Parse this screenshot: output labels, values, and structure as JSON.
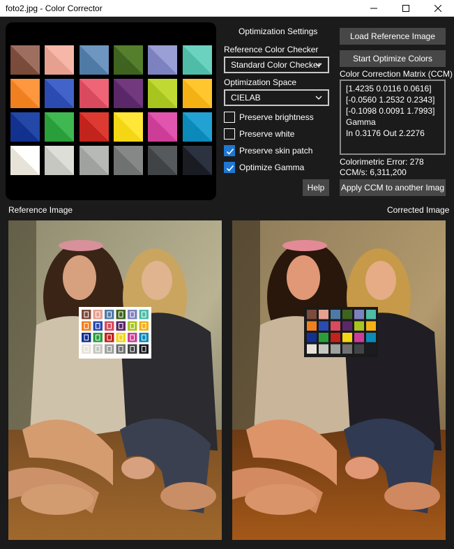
{
  "window": {
    "title": "foto2.jpg - Color Corrector",
    "minimize_icon": "minimize-icon",
    "maximize_icon": "maximize-icon",
    "close_icon": "close-icon"
  },
  "checker": {
    "patches": [
      [
        "#7b4b3b",
        "#9e6f60"
      ],
      [
        "#e6a090",
        "#f7b7a8"
      ],
      [
        "#4f7aa6",
        "#6e96c0"
      ],
      [
        "#3f6320",
        "#557f2c"
      ],
      [
        "#7d82bf",
        "#9a9fd6"
      ],
      [
        "#4fbca8",
        "#6bd2c0"
      ],
      [
        "#f0801f",
        "#ff9740"
      ],
      [
        "#2b4bb0",
        "#4263c9"
      ],
      [
        "#d94a5e",
        "#f06478"
      ],
      [
        "#5a2868",
        "#73397f"
      ],
      [
        "#a8c41f",
        "#c0da33"
      ],
      [
        "#f5b014",
        "#ffc62d"
      ],
      [
        "#13318f",
        "#2448a8"
      ],
      [
        "#2a9e3b",
        "#3fb852"
      ],
      [
        "#c2231c",
        "#dd3a32"
      ],
      [
        "#f3d614",
        "#ffe637"
      ],
      [
        "#cc3d97",
        "#e255ae"
      ],
      [
        "#0c8ab8",
        "#21a2d2"
      ],
      [
        "#e8e3d8",
        "#ffffff"
      ],
      [
        "#c6c7c1",
        "#deded9"
      ],
      [
        "#9fa29f",
        "#b6b9b6"
      ],
      [
        "#6f7270",
        "#858886"
      ],
      [
        "#414446",
        "#565a5c"
      ],
      [
        "#1a1c22",
        "#2c3240"
      ]
    ]
  },
  "settings": {
    "heading": "Optimization Settings",
    "reference_label": "Reference Color Checker",
    "reference_value": "Standard Color Checker",
    "space_label": "Optimization Space",
    "space_value": "CIELAB",
    "options": [
      {
        "label": "Preserve brightness",
        "checked": false
      },
      {
        "label": "Preserve white",
        "checked": false
      },
      {
        "label": "Preserve skin patch",
        "checked": true
      },
      {
        "label": "Optimize Gamma",
        "checked": true
      }
    ],
    "help_label": "Help"
  },
  "actions": {
    "load_label": "Load Reference Image",
    "optimize_label": "Start Optimize Colors",
    "apply_label": "Apply CCM to another Imag"
  },
  "ccm": {
    "label": "Color Correction Matrix (CCM)",
    "lines": [
      "[1.4235 0.0116 0.0616]",
      "[-0.0560 1.2532 0.2343]",
      "[-0.1098 0.0091 1.7993]",
      "Gamma",
      "In 0.3176 Out 2.2276"
    ],
    "error_text": "Colorimetric Error: 278",
    "rate_text": "CCM/s: 6,311,200"
  },
  "images": {
    "reference_label": "Reference Image",
    "corrected_label": "Corrected Image"
  }
}
